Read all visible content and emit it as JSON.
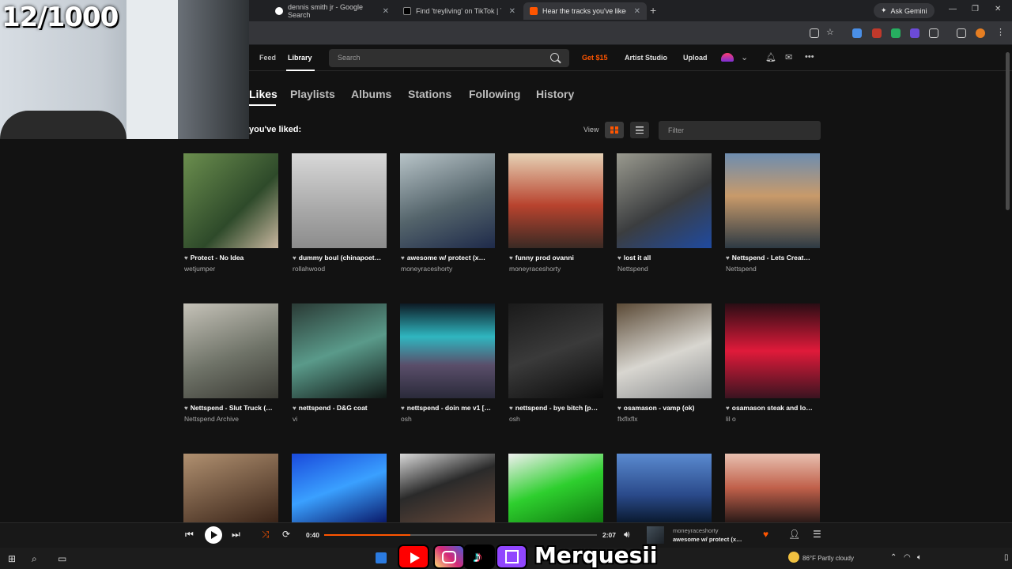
{
  "stream_overlay": {
    "counter": "12/1000",
    "handle": "Merquesii"
  },
  "browser": {
    "tabs": [
      {
        "title": "dennis smith jr - Google Search",
        "icon": "google-icon",
        "color": "#4285f4"
      },
      {
        "title": "Find 'treyliving' on TikTok | TikT",
        "icon": "tiktok-icon",
        "color": "#ffffff"
      },
      {
        "title": "Hear the tracks you've liked: on",
        "icon": "soundcloud-icon",
        "color": "#ff5500"
      }
    ],
    "ask_gemini": "Ask Gemini"
  },
  "header": {
    "nav": [
      "Feed",
      "Library"
    ],
    "search_placeholder": "Search",
    "get15": "Get $15",
    "artist_studio": "Artist Studio",
    "upload": "Upload"
  },
  "library": {
    "tabs": [
      "Likes",
      "Playlists",
      "Albums",
      "Stations",
      "Following",
      "History"
    ],
    "heading": "you've liked:",
    "view_label": "View",
    "filter_placeholder": "Filter"
  },
  "tracks": [
    {
      "title": "Protect - No Idea",
      "artist": "wetjumper"
    },
    {
      "title": "dummy boul (chinapoet…",
      "artist": "rollahwood"
    },
    {
      "title": "awesome w/ protect (x…",
      "artist": "moneyraceshorty"
    },
    {
      "title": "funny prod ovanni",
      "artist": "moneyraceshorty"
    },
    {
      "title": "lost it all",
      "artist": "Nettspend"
    },
    {
      "title": "Nettspend - Lets Creat…",
      "artist": "Nettspend"
    },
    {
      "title": "Nettspend - Slut Truck (…",
      "artist": "Nettspend Archive"
    },
    {
      "title": "nettspend - D&G coat",
      "artist": "vi"
    },
    {
      "title": "nettspend - doin me v1 […",
      "artist": "osh"
    },
    {
      "title": "nettspend - bye bitch [p…",
      "artist": "osh"
    },
    {
      "title": "osamason - vamp (ok)",
      "artist": "flxflxflx"
    },
    {
      "title": "osamason steak and lo…",
      "artist": "lil o"
    },
    {
      "title": "",
      "artist": ""
    },
    {
      "title": "",
      "artist": ""
    },
    {
      "title": "",
      "artist": ""
    },
    {
      "title": "",
      "artist": ""
    },
    {
      "title": "",
      "artist": ""
    },
    {
      "title": "",
      "artist": ""
    }
  ],
  "player": {
    "current_time": "0:40",
    "duration": "2:07",
    "progress": 0.315,
    "artist": "moneyraceshorty",
    "title": "awesome w/ protect (x…"
  },
  "taskbar": {
    "weather": "86°F  Partly cloudy"
  }
}
